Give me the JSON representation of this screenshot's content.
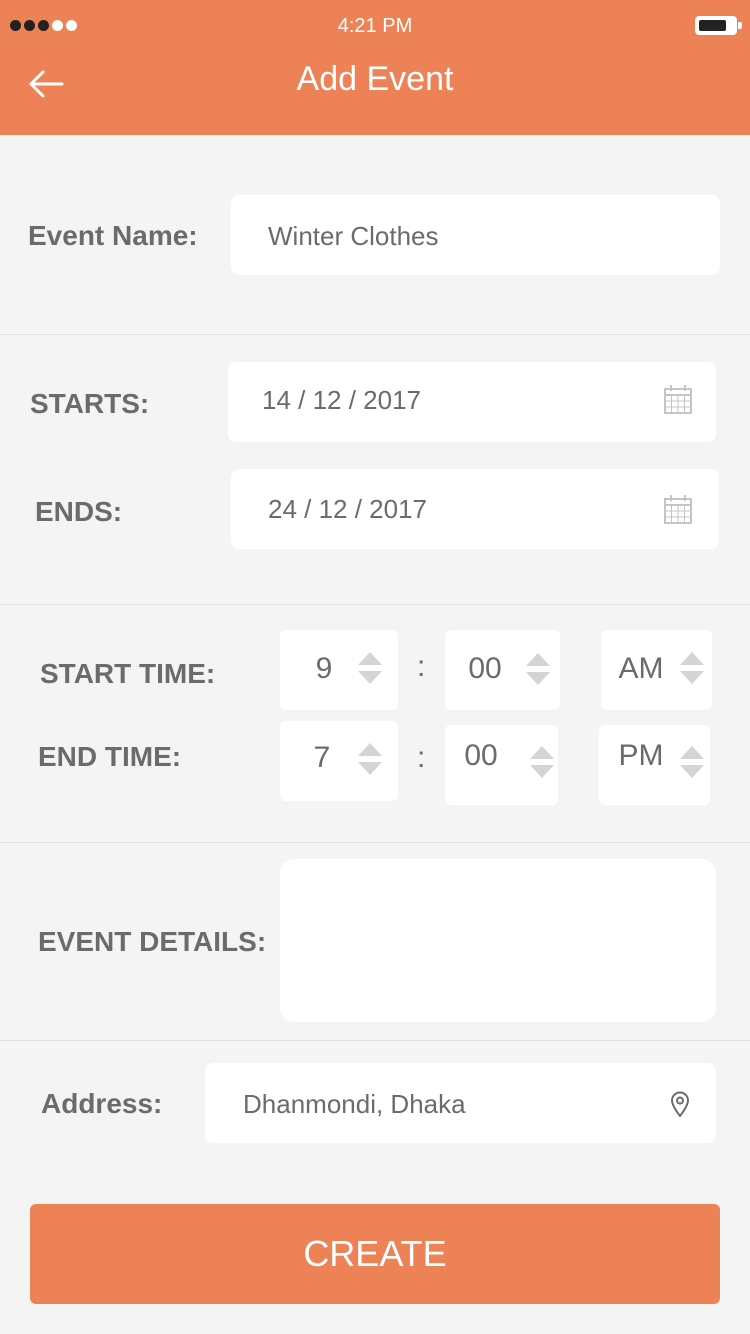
{
  "status_bar": {
    "time": "4:21 PM"
  },
  "header": {
    "title": "Add Event"
  },
  "event_name": {
    "label": "Event Name:",
    "value": "Winter Clothes"
  },
  "starts": {
    "label": "STARTS:",
    "value": "14 / 12 / 2017"
  },
  "ends": {
    "label": "ENDS:",
    "value": "24 / 12 / 2017"
  },
  "start_time": {
    "label": "START TIME:",
    "hour": "9",
    "minute": "00",
    "period": "AM"
  },
  "end_time": {
    "label": "END TIME:",
    "hour": "7",
    "minute": "00",
    "period": "PM"
  },
  "time_separator": ":",
  "event_details": {
    "label": "EVENT DETAILS:",
    "value": ""
  },
  "address": {
    "label": "Address:",
    "value": "Dhanmondi, Dhaka"
  },
  "create_button": {
    "label": "CREATE"
  },
  "icons": {
    "back": "arrow-left-icon",
    "calendar": "calendar-icon",
    "location": "map-pin-icon",
    "stepper": "up-down-arrows-icon"
  },
  "colors": {
    "accent": "#ec8256",
    "background": "#f4f4f4",
    "text": "#6b6b6b",
    "field": "#ffffff"
  }
}
